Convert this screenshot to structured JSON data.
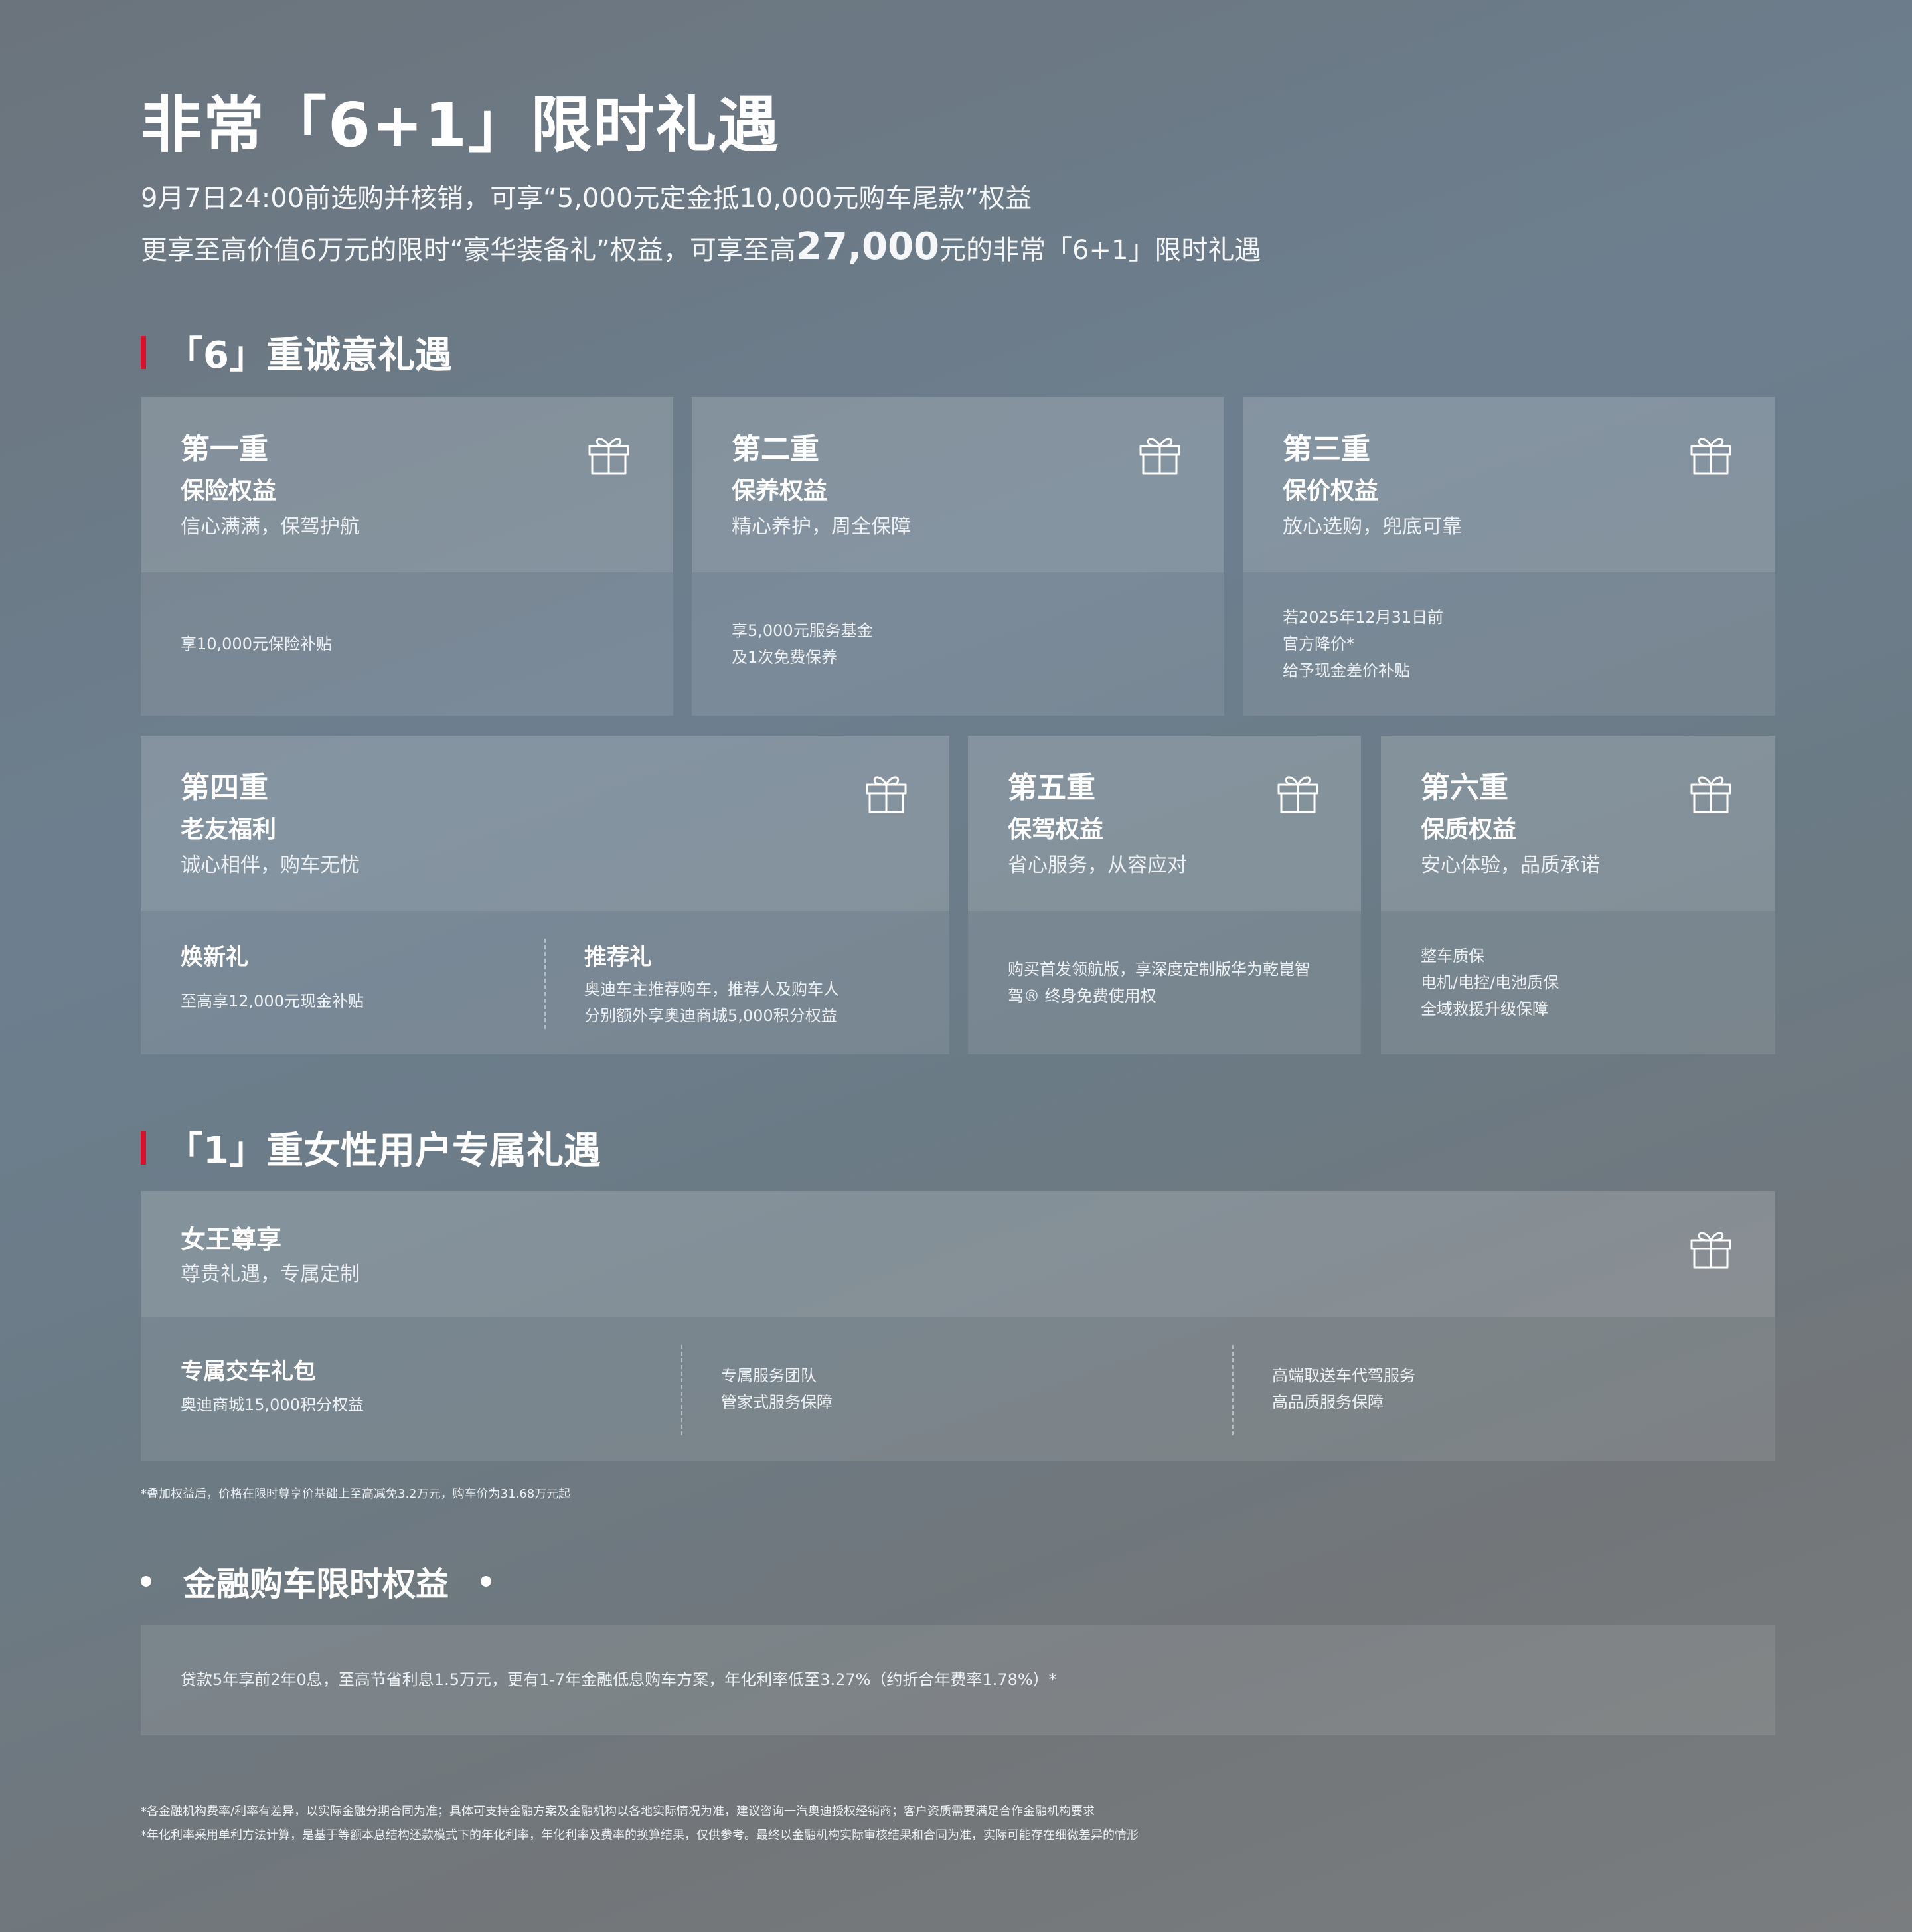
{
  "header": {
    "title": "非常「6+1」限时礼遇",
    "line1": "9月7日24:00前选购并核销，可享“5,000元定金抵10,000元购车尾款”权益",
    "line2_a": "更享至高价值6万元的限时“豪华装备礼”权益，可享至高",
    "line2_big": "27,000",
    "line2_b": "元的非常「6+1」限时礼遇"
  },
  "section6": {
    "heading": "「6」重诚意礼遇",
    "cards": [
      {
        "title": "第一重",
        "subtitle": "保险权益",
        "desc": "信心满满，保驾护航",
        "body": [
          "享10,000元保险补贴"
        ]
      },
      {
        "title": "第二重",
        "subtitle": "保养权益",
        "desc": "精心养护，周全保障",
        "body": [
          "享5,000元服务基金",
          "及1次免费保养"
        ]
      },
      {
        "title": "第三重",
        "subtitle": "保价权益",
        "desc": "放心选购，兜底可靠",
        "body": [
          "若2025年12月31日前",
          "官方降价*",
          "给予现金差价补贴"
        ]
      },
      {
        "title": "第四重",
        "subtitle": "老友福利",
        "desc": "诚心相伴，购车无忧",
        "left_head": "焕新礼",
        "left_body": [
          "至高享12,000元现金补贴"
        ],
        "right_head": "推荐礼",
        "right_body": [
          "奥迪车主推荐购车，推荐人及购车人",
          "分别额外享奥迪商城5,000积分权益"
        ]
      },
      {
        "title": "第五重",
        "subtitle": "保驾权益",
        "desc": "省心服务，从容应对",
        "body": [
          "购买首发领航版，享深度定制版华为乾崑智",
          "驾® 终身免费使用权"
        ]
      },
      {
        "title": "第六重",
        "subtitle": "保质权益",
        "desc": "安心体验，品质承诺",
        "body": [
          "整车质保",
          "电机/电控/电池质保",
          "全域救援升级保障"
        ]
      }
    ]
  },
  "section1": {
    "heading": "「1」重女性用户专属礼遇",
    "card": {
      "title": "女王尊享",
      "desc": "尊贵礼遇，专属定制",
      "col1_head": "专属交车礼包",
      "col1_body": [
        "奥迪商城15,000积分权益"
      ],
      "col2_body": [
        "专属服务团队",
        "管家式服务保障"
      ],
      "col3_body": [
        "高端取送车代驾服务",
        "高品质服务保障"
      ]
    },
    "footnote": "*叠加权益后，价格在限时尊享价基础上至高减免3.2万元，购车价为31.68万元起"
  },
  "finance": {
    "heading": "金融购车限时权益",
    "body": "贷款5年享前2年0息，至高节省利息1.5万元，更有1-7年金融低息购车方案，年化利率低至3.27%（约折合年费率1.78%）*",
    "notes": [
      "*各金融机构费率/利率有差异，以实际金融分期合同为准；具体可支持金融方案及金融机构以各地实际情况为准，建议咨询一汽奥迪授权经销商；客户资质需要满足合作金融机构要求",
      "*年化利率采用单利方法计算，是基于等额本息结构还款模式下的年化利率，年化利率及费率的换算结果，仅供参考。最终以金融机构实际审核结果和合同为准，实际可能存在细微差异的情形"
    ]
  },
  "colors": {
    "accent": "#d8102b"
  },
  "icons": [
    "gift-icon"
  ]
}
